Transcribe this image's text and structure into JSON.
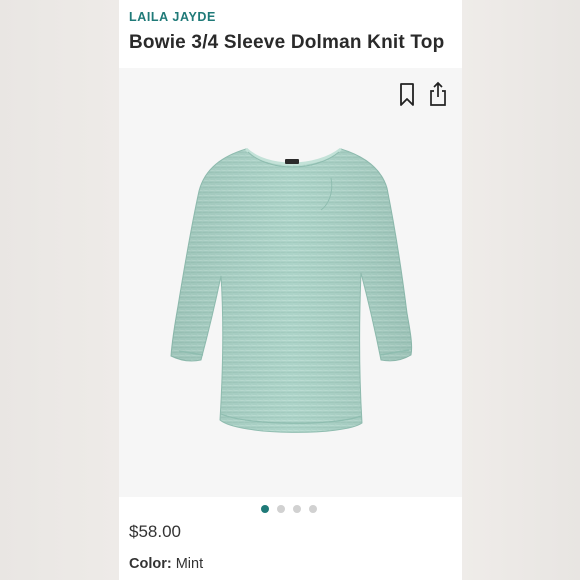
{
  "product": {
    "brand": "LAILA JAYDE",
    "title": "Bowie 3/4 Sleeve Dolman Knit Top",
    "price": "$58.00",
    "color_label": "Color:",
    "color_value": "Mint"
  },
  "icons": {
    "save": "bookmark-icon",
    "share": "share-icon"
  },
  "carousel": {
    "total_slides": 4,
    "active_index": 0
  },
  "colors": {
    "brand_accent": "#1f7a78",
    "garment": "#a9d2c6",
    "active_dot": "#1f7a78",
    "inactive_dot": "#d1d1d1"
  }
}
